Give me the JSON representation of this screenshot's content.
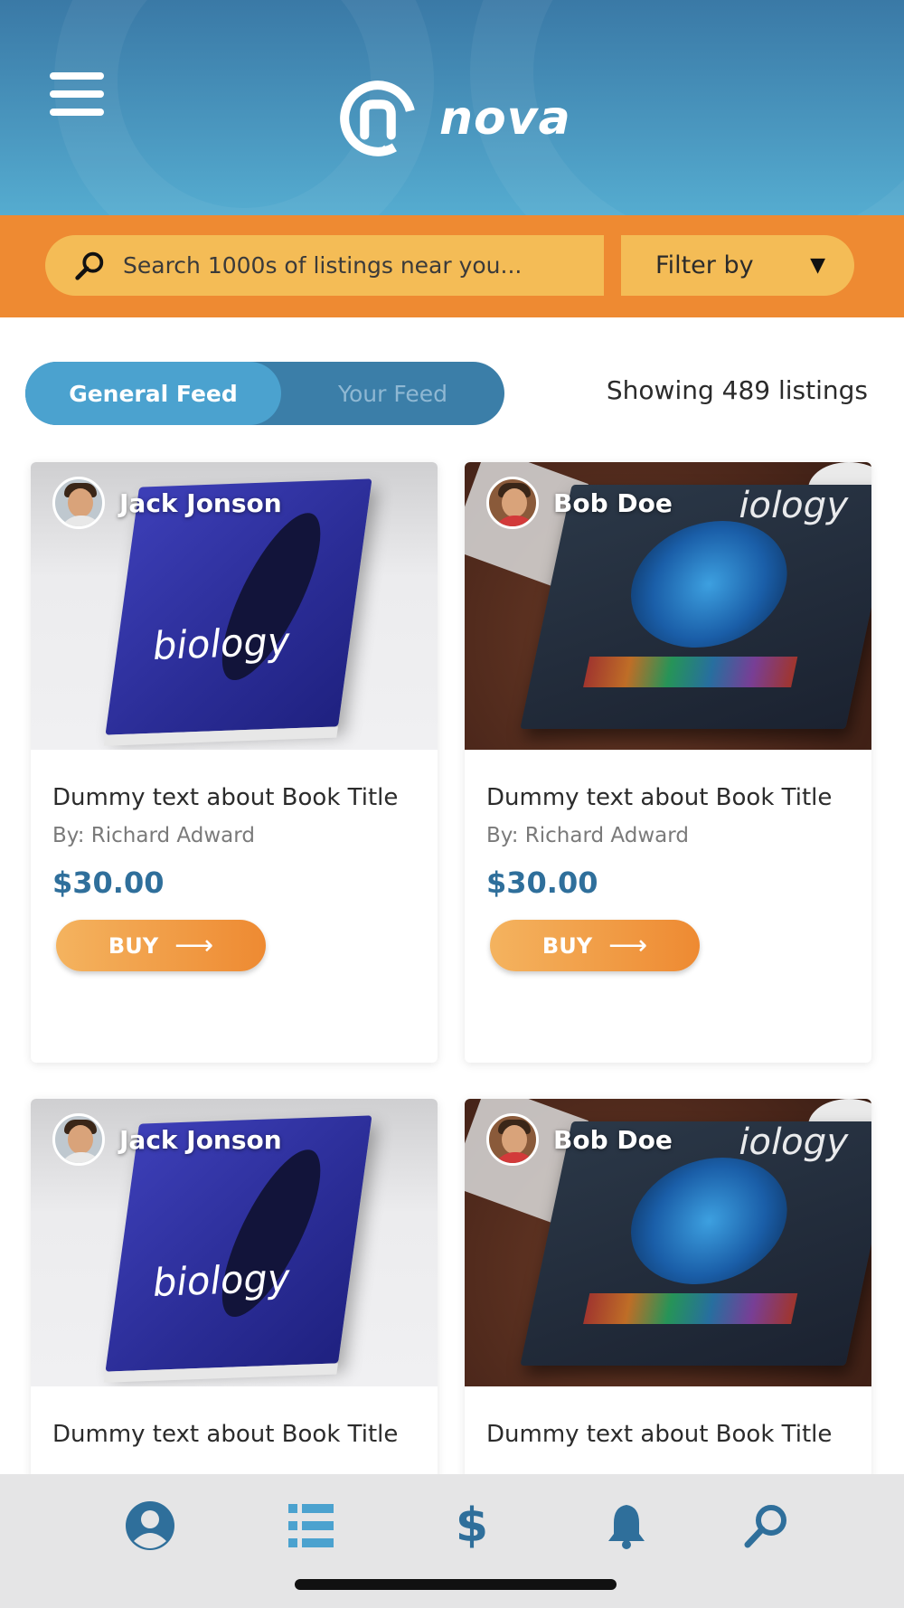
{
  "header": {
    "brand": "nova",
    "colors": {
      "header_blue": "#3a79a6",
      "accent_orange": "#ee8a32",
      "search_yellow": "#f4bc56",
      "price_blue": "#2f6f9b"
    }
  },
  "search": {
    "placeholder": "Search 1000s of listings near you...",
    "value": "",
    "filter_label": "Filter by",
    "filter_arrow": "▼"
  },
  "feed": {
    "tabs": [
      {
        "label": "General Feed",
        "active": true
      },
      {
        "label": "Your Feed",
        "active": false
      }
    ],
    "listing_count_text": "Showing 489 listings"
  },
  "listings": [
    {
      "seller": "Jack Jonson",
      "title": "Dummy text about Book Title",
      "author": "By: Richard Adward",
      "price": "$30.00",
      "buy_label": "BUY",
      "cover_word": "biology"
    },
    {
      "seller": "Bob Doe",
      "title": "Dummy text about Book Title",
      "author": "By: Richard Adward",
      "price": "$30.00",
      "buy_label": "BUY",
      "cover_word": "iology"
    },
    {
      "seller": "Jack Jonson",
      "title": "Dummy text about Book Title",
      "cover_word": "biology"
    },
    {
      "seller": "Bob Doe",
      "title": "Dummy text about Book Title",
      "cover_word": "iology"
    }
  ],
  "bottom_nav": {
    "items": [
      {
        "icon": "user-icon"
      },
      {
        "icon": "list-icon"
      },
      {
        "icon": "dollar-icon"
      },
      {
        "icon": "bell-icon"
      },
      {
        "icon": "search-icon"
      }
    ],
    "dollar_glyph": "$"
  }
}
